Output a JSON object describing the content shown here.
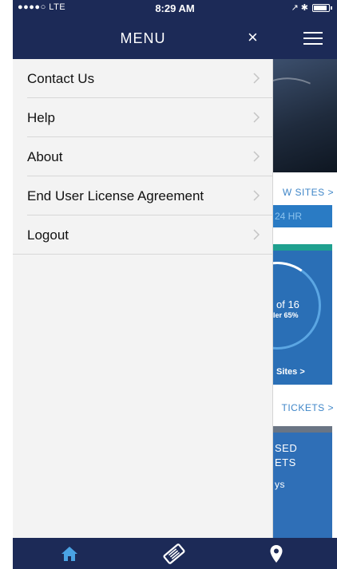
{
  "status_bar": {
    "carrier": "●●●●○ LTE",
    "time": "8:29 AM",
    "right_indicators": "↗ ✱"
  },
  "header": {
    "title": "MENU",
    "close_glyph": "×"
  },
  "menu": {
    "items": [
      {
        "label": "Contact Us"
      },
      {
        "label": "Help"
      },
      {
        "label": "About"
      },
      {
        "label": "End User License Agreement"
      },
      {
        "label": "Logout"
      }
    ]
  },
  "background": {
    "view_sites_link": "W SITES >",
    "hr_box": "24 HR",
    "ring_count": "of 16",
    "ring_sub": "ler 65%",
    "sites_link": "Sites >",
    "tickets_link": "TICKETS >",
    "card_line1": "SED",
    "card_line2": "ETS",
    "card_line3": "ys"
  },
  "tab_bar": {
    "tabs": [
      {
        "icon": "home-icon",
        "active": true
      },
      {
        "icon": "ticket-icon",
        "active": false
      },
      {
        "icon": "map-pin-icon",
        "active": false
      }
    ]
  },
  "colors": {
    "nav_bg": "#1c2a57",
    "panel_bg": "#f3f3f3",
    "accent_blue": "#3f86c8",
    "active_tab": "#4aa3e4",
    "teal": "#1fa08f"
  }
}
